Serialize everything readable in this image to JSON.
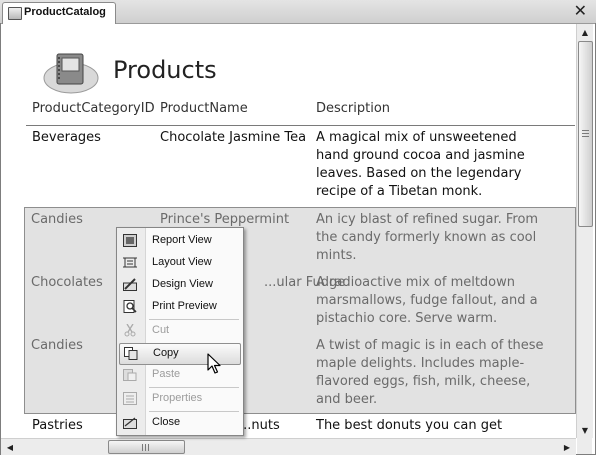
{
  "window": {
    "tab_title": "ProductCatalog",
    "close_symbol": "✕"
  },
  "form": {
    "title": "Products",
    "icon": "form-icon"
  },
  "columns": [
    "ProductCategoryID",
    "ProductName",
    "Description"
  ],
  "rows": [
    {
      "category": "Beverages",
      "name": "Chocolate Jasmine Tea",
      "description": [
        "A magical mix of unsweetened",
        "hand ground cocoa and jasmine",
        "leaves. Based on the legendary",
        "recipe of a Tibetan monk."
      ]
    },
    {
      "category": "Candies",
      "name": "Prince's Peppermint",
      "description": [
        "An icy blast of refined sugar. From",
        "the candy formerly known as cool",
        "mints."
      ]
    },
    {
      "category": "Chocolates",
      "name": "...ular Fudge",
      "description": [
        "A radioactive mix of meltdown",
        "marsmallows, fudge fallout, and a",
        "pistachio core. Serve warm."
      ]
    },
    {
      "category": "Candies",
      "name": "",
      "description": [
        "A twist of magic is in each of these",
        "maple delights. Includes maple-",
        "flavored eggs, fish, milk, cheese,",
        "and beer."
      ]
    },
    {
      "category": "Pastries",
      "name": "...nuts",
      "description": [
        "The best donuts you can get"
      ]
    }
  ],
  "context_menu": [
    {
      "label": "Report View",
      "icon": "report-view-icon",
      "enabled": true
    },
    {
      "label": "Layout View",
      "icon": "layout-view-icon",
      "enabled": true
    },
    {
      "label": "Design View",
      "icon": "design-view-icon",
      "enabled": true
    },
    {
      "label": "Print Preview",
      "icon": "print-preview-icon",
      "enabled": true
    },
    {
      "label": "Cut",
      "icon": "scissors-icon",
      "enabled": false
    },
    {
      "label": "Copy",
      "icon": "copy-icon",
      "enabled": true,
      "highlighted": true
    },
    {
      "label": "Paste",
      "icon": "paste-icon",
      "enabled": false
    },
    {
      "label": "Properties",
      "icon": "properties-icon",
      "enabled": false
    },
    {
      "label": "Close",
      "icon": "close-view-icon",
      "enabled": true
    }
  ],
  "scrollbar_arrows": {
    "up": "▲",
    "down": "▼",
    "left": "◀",
    "right": "▶"
  },
  "colors": {
    "selection_bg": "#e2e2e2",
    "disabled_text": "#9c9c9c",
    "dim_text": "#6a6a6a"
  }
}
